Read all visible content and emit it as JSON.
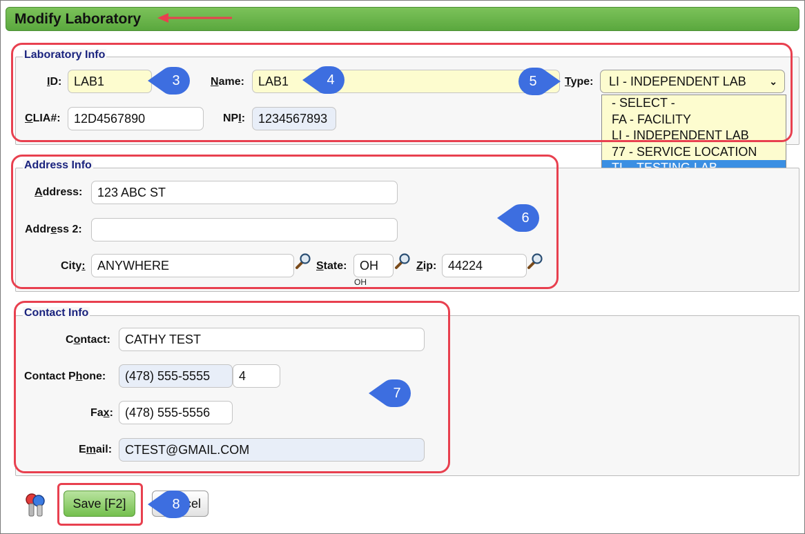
{
  "header": {
    "title": "Modify Laboratory"
  },
  "lab_info": {
    "legend": "Laboratory Info",
    "id": {
      "label_u": "I",
      "label_rest": "D:",
      "value": "LAB1"
    },
    "name": {
      "label_u": "N",
      "label_rest": "ame:",
      "value": "LAB1"
    },
    "type": {
      "label_u": "T",
      "label_rest": "ype:",
      "value": "LI - INDEPENDENT LAB",
      "options": [
        "- SELECT -",
        "FA - FACILITY",
        "LI - INDEPENDENT LAB",
        "77 - SERVICE LOCATION",
        "TL - TESTING LAB"
      ]
    },
    "clia": {
      "label_u": "C",
      "label_rest": "LIA#:",
      "value": "12D4567890"
    },
    "npi": {
      "label_pre": "NP",
      "label_u": "I",
      "label_rest": ":",
      "value": "1234567893"
    }
  },
  "address_info": {
    "legend": "Address Info",
    "address": {
      "label_u": "A",
      "label_rest": "ddress:",
      "value": "123 ABC ST"
    },
    "address2": {
      "label_pre": "Addr",
      "label_u": "e",
      "label_rest": "ss 2:",
      "value": ""
    },
    "city": {
      "label_pre": "City",
      "label_u": ":",
      "value": "ANYWHERE"
    },
    "state": {
      "label_u": "S",
      "label_rest": "tate:",
      "value": "OH",
      "hint": "OH"
    },
    "zip": {
      "label_u": "Z",
      "label_rest": "ip:",
      "value": "44224"
    }
  },
  "contact_info": {
    "legend": "Contact Info",
    "contact": {
      "label_pre": "C",
      "label_u": "o",
      "label_rest": "ntact:",
      "value": "CATHY TEST"
    },
    "phone": {
      "label_pre": "Contact P",
      "label_u": "h",
      "label_rest": "one:",
      "value": "(478) 555-5555",
      "ext": "4"
    },
    "fax": {
      "label_pre": "Fa",
      "label_u": "x",
      "label_rest": ":",
      "value": "(478) 555-5556"
    },
    "email": {
      "label_pre": "E",
      "label_u": "m",
      "label_rest": "ail:",
      "value": "CTEST@GMAIL.COM"
    }
  },
  "footer": {
    "save_label": "Save [F2]",
    "cancel_label": "Cancel"
  },
  "callouts": [
    "3",
    "4",
    "5",
    "6",
    "7",
    "8"
  ],
  "colors": {
    "header_green": "#5aa83e",
    "callout_blue": "#3d6ee0",
    "highlight_red": "#e8404f",
    "field_yellow": "#fdfccf",
    "field_blue": "#e8eef8"
  },
  "icons": {
    "lookup": "magnifier-icon",
    "keys": "keys-icon",
    "chevron": "chevron-down-icon"
  }
}
